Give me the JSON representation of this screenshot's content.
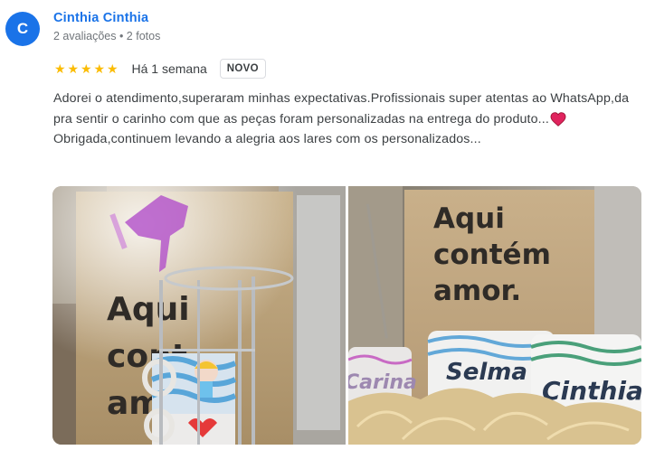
{
  "reviewer": {
    "initial": "C",
    "name": "Cinthia Cinthia",
    "meta": "2 avaliações • 2 fotos"
  },
  "review": {
    "rating": 5,
    "time": "Há 1 semana",
    "badge": "NOVO",
    "line1": "Adorei o atendimento,superaram minhas expectativas.Profissionais super atentas ao WhatsApp,da pra sentir o carinho com que as peças foram personalizadas na entrega do produto...",
    "line2": "Obrigada,continuem levando a alegria aos lares com os personalizados..."
  },
  "photos": [
    {
      "bag_text": [
        "Aqui",
        "cont",
        "amor"
      ]
    },
    {
      "bag_text": [
        "Aqui",
        "contém",
        "amor."
      ],
      "mug_names": [
        "Selma",
        "Cinthia",
        "Carina"
      ]
    }
  ],
  "colors": {
    "accent": "#1a73e8",
    "star": "#fbbc04",
    "heart": "#e0245e"
  }
}
